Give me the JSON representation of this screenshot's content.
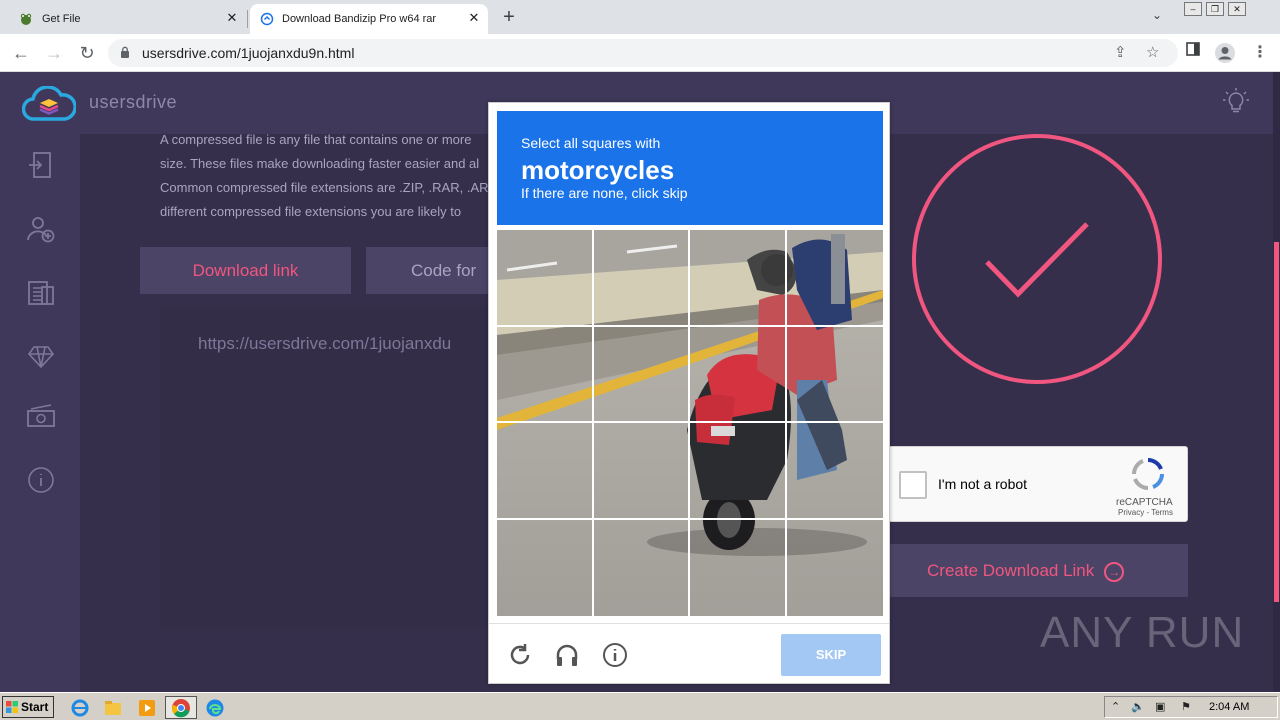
{
  "browser": {
    "tabs": [
      {
        "title": "Get File",
        "active": false
      },
      {
        "title": "Download Bandizip Pro w64 rar",
        "active": true
      }
    ],
    "new_tab_symbol": "+",
    "url": "usersdrive.com/1juojanxdu9n.html",
    "icons": [
      "back-icon",
      "forward-icon",
      "reload-icon",
      "lock-icon",
      "share-icon",
      "star-icon",
      "sidepanel-icon",
      "profile-icon",
      "menu-icon"
    ]
  },
  "site": {
    "brand": "usersdrive",
    "description": "A compressed file is any file that contains one or more size. These files make downloading faster easier and al Common compressed file extensions are .ZIP, .RAR, .AR different compressed file extensions you are likely to",
    "description_lines": [
      "A compressed file is any file that contains one or more",
      "size. These files make downloading faster easier and al",
      "Common compressed file extensions are .ZIP, .RAR, .AR",
      "different compressed file extensions you are likely to"
    ],
    "download_link_tab": "Download link",
    "code_tab": "Code for",
    "link_url": "https://usersdrive.com/1juojanxdu",
    "create_button": "Create Download Link",
    "accent": "#f0567f"
  },
  "recaptcha_widget": {
    "label": "I'm not a robot",
    "brand": "reCAPTCHA",
    "links": "Privacy - Terms",
    "checked": false
  },
  "captcha": {
    "line1": "Select all squares with",
    "target": "motorcycles",
    "line3": "If there are none, click skip",
    "grid_size": "4x4",
    "skip_label": "SKIP",
    "header_color": "#1a73e8"
  },
  "watermark": "ANY RUN",
  "taskbar": {
    "start_label": "Start",
    "clock": "2:04 AM"
  }
}
